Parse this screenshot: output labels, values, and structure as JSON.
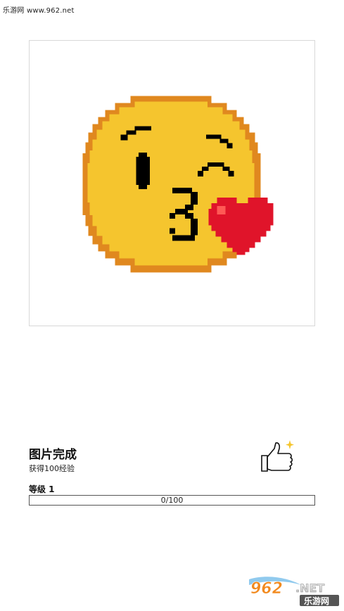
{
  "watermark": {
    "text": "乐游网 www.962.net"
  },
  "artwork": {
    "subject": "kissing-face-emoji",
    "icon": "kissing-face-pixel-art"
  },
  "completion": {
    "title": "图片完成",
    "subtitle": "获得100经验",
    "like_icon": "thumbs-up-icon"
  },
  "level": {
    "label": "等级 1",
    "progress_text": "0/100",
    "progress_fraction": 0
  },
  "logo": {
    "number": "962",
    "suffix": ".NET",
    "chinese": "乐游网"
  },
  "colors": {
    "face_fill": "#f5c52e",
    "face_outline": "#e0881f",
    "heart": "#e0142a",
    "heart_highlight": "#ff5a55",
    "features": "#000000"
  }
}
